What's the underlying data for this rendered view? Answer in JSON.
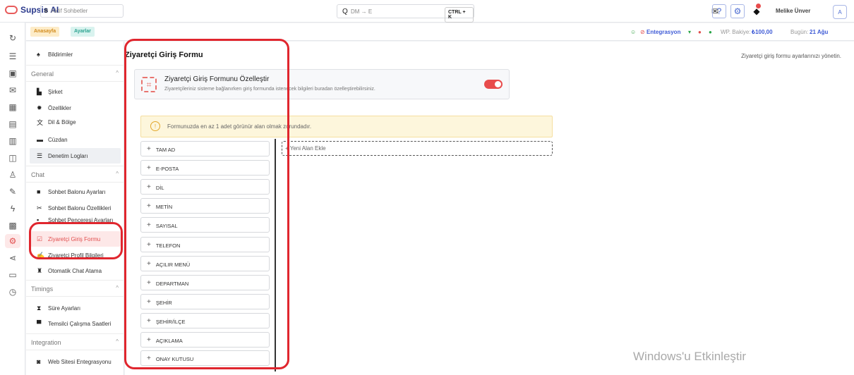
{
  "topbar": {
    "brand": "Supsis AI",
    "active_count": "0",
    "active_label": "Aktif Sohbetler",
    "search_placeholder": "DM → E",
    "search_shortcut": "CTRL + K",
    "user_name": "Melike Ünver",
    "avatar_initial": "A"
  },
  "subheader": {
    "crumb_home": "Anasayfa",
    "crumb_settings": "Ayarlar",
    "integration_label": "Entegrasyon",
    "balance_label": "WP. Bakiye:",
    "balance_value": "₺100,00",
    "today_label": "Bugün:",
    "today_value": "21 Ağu"
  },
  "sidebar": {
    "notifications": "Bildirimler",
    "sections": {
      "general": "General",
      "chat": "Chat",
      "timings": "Timings",
      "integration": "Integration"
    },
    "general_items": [
      "Şirket",
      "Özellikler",
      "Dil & Bölge",
      "Cüzdan",
      "Denetim Logları"
    ],
    "chat_items": [
      "Sohbet Balonu Ayarları",
      "Sohbet Balonu Özellikleri",
      "Sohbet Penceresi Ayarları",
      "Ziyaretçi Giriş Formu",
      "Ziyaretçi Profil Bilgileri",
      "Otomatik Chat Atama"
    ],
    "timing_items": [
      "Süre Ayarları",
      "Temsilci Çalışma Saatleri"
    ],
    "integration_items": [
      "Web Sitesi Entegrasyonu"
    ]
  },
  "main": {
    "title": "Ziyaretçi Giriş Formu",
    "description": "Ziyaretçi giriş formu ayarlarınızı yönetin.",
    "customize_title": "Ziyaretçi Giriş Formunu Özelleştir",
    "customize_desc": "Ziyaretçileriniz sisteme bağlanırken giriş formunda istenecek bilgileri buradan özelleştirebilirsiniz.",
    "customize_enabled": true,
    "warning": "Formunuzda en az 1 adet görünür alan olmak zorundadır.",
    "fields": [
      "TAM AD",
      "E-POSTA",
      "DİL",
      "METİN",
      "SAYISAL",
      "TELEFON",
      "AÇILIR MENÜ",
      "DEPARTMAN",
      "ŞEHİR",
      "ŞEHİR/İLÇE",
      "AÇIKLAMA",
      "ONAY KUTUSU"
    ],
    "add_field": "+ Yeni Alan Ekle"
  },
  "overlay": {
    "watermark": "Windows'u Etkinleştir"
  },
  "colors": {
    "accent": "#e84c4c",
    "brand": "#2b3a8c",
    "warning_bg": "#fdf6dc",
    "annotation": "#e0262e"
  }
}
